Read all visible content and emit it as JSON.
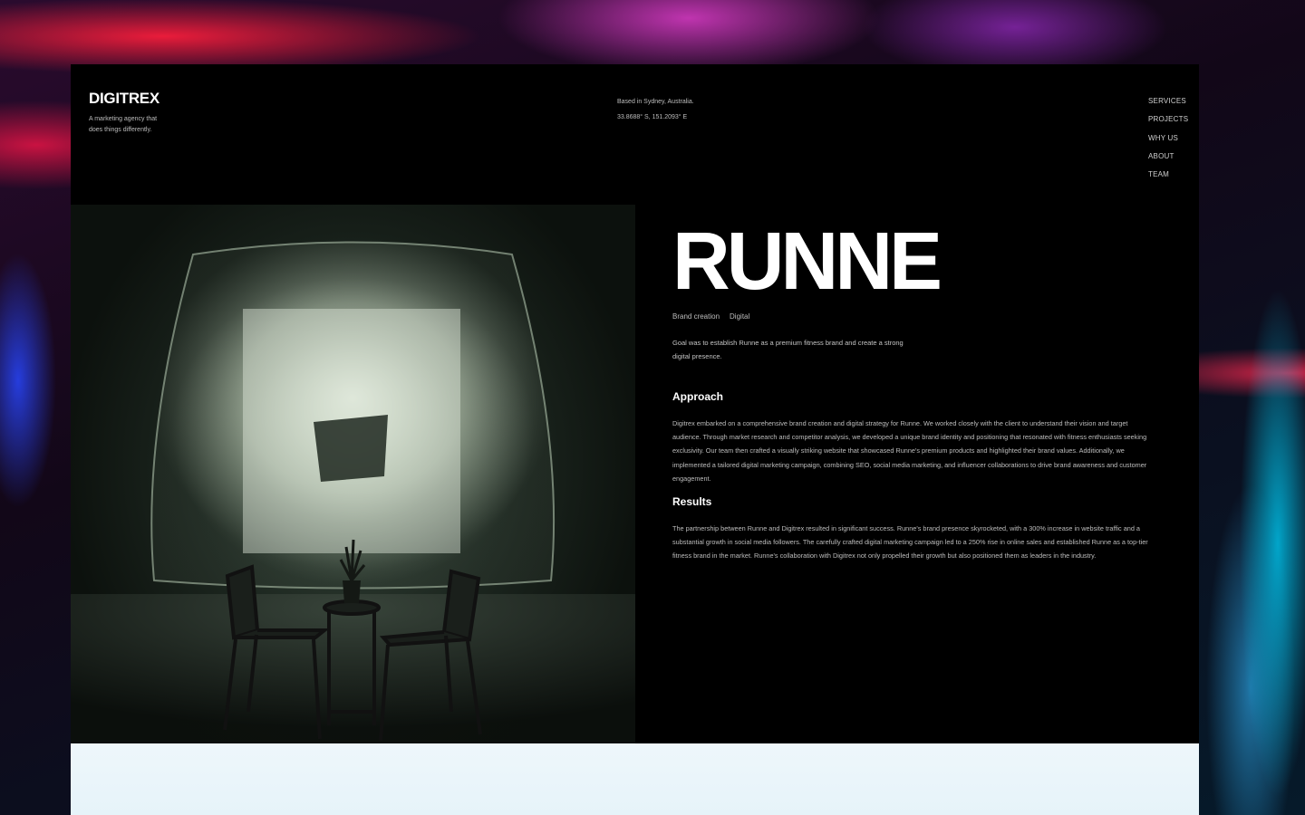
{
  "header": {
    "logo": "DIGITREX",
    "tagline": "A marketing agency that does things differently.",
    "location_line1": "Based in Sydney, Australia.",
    "location_line2": "33.8688° S, 151.2093° E"
  },
  "nav": {
    "items": [
      {
        "label": "SERVICES"
      },
      {
        "label": "PROJECTS"
      },
      {
        "label": "WHY US"
      },
      {
        "label": "ABOUT"
      },
      {
        "label": "TEAM"
      }
    ]
  },
  "project": {
    "title": "RUNNE",
    "tags": [
      "Brand creation",
      "Digital"
    ],
    "goal": "Goal was to establish Runne as a premium fitness brand and create a strong digital presence.",
    "approach_heading": "Approach",
    "approach_text": "Digitrex embarked on a comprehensive brand creation and digital strategy for Runne. We worked closely with the client to understand their vision and target audience. Through market research and competitor analysis, we developed a unique brand identity and positioning that resonated with fitness enthusiasts seeking exclusivity. Our team then crafted a visually striking website that showcased Runne's premium products and highlighted their brand values. Additionally, we implemented a tailored digital marketing campaign, combining SEO, social media marketing, and influencer collaborations to drive brand awareness and customer engagement.",
    "results_heading": "Results",
    "results_text": "The partnership between Runne and Digitrex resulted in significant success. Runne's brand presence skyrocketed, with a 300% increase in website traffic and a substantial growth in social media followers. The carefully crafted digital marketing campaign led to a 250% rise in online sales and established Runne as a top-tier fitness brand in the market. Runne's collaboration with Digitrex not only propelled their growth but also positioned them as leaders in the industry."
  },
  "colors": {
    "frame_bg": "#000000",
    "text_primary": "#ffffff",
    "text_secondary": "#bdbdbd",
    "bottom_band": "#eef7fb"
  }
}
